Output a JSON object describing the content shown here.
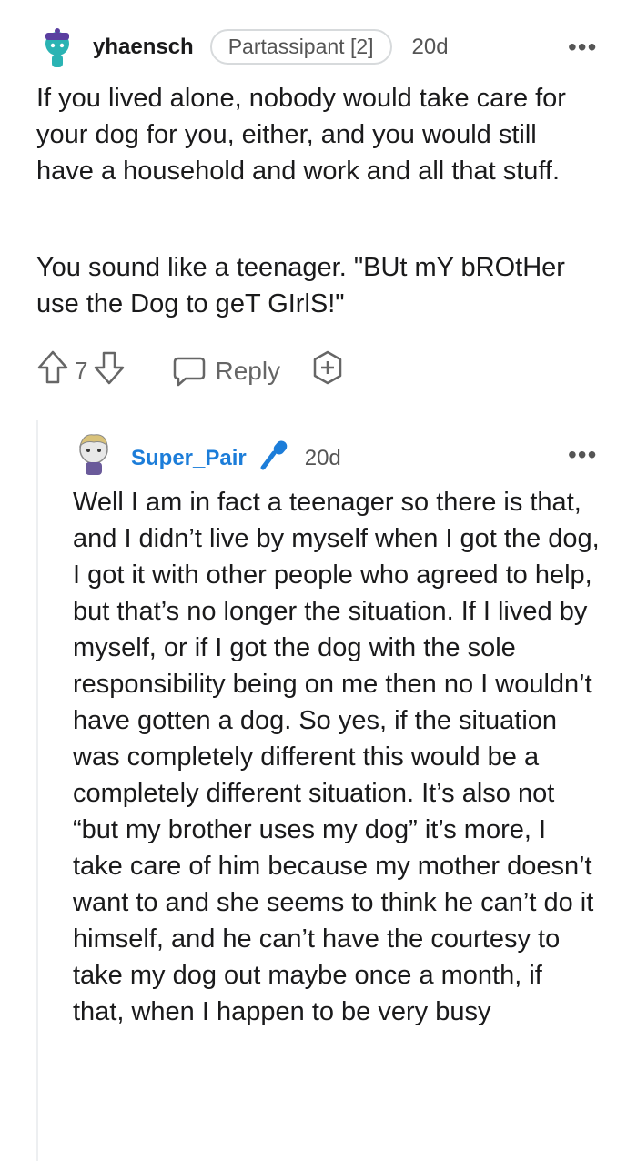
{
  "comment": {
    "username": "yhaensch",
    "flair": "Partassipant [2]",
    "time": "20d",
    "more_icon": "more-dots-icon",
    "paragraphs": [
      "If you lived alone, nobody would take care for your dog for you, either, and you would still have a household and work and all that stuff.",
      "You sound like a teenager. \"BUt mY bROtHer use the Dog to geT GIrlS!\""
    ],
    "vote_count": "7",
    "reply_label": "Reply"
  },
  "reply": {
    "username": "Super_Pair",
    "time": "20d",
    "body": "Well I am in fact a teenager so there is that, and I didn’t live by myself when I got the dog, I got it with other people who agreed to help, but that’s no longer the situation. If I lived by myself, or if I got the dog with the sole responsibility being on me then no I wouldn’t have gotten a dog. So yes, if the situation was completely different this would be a completely different situation. It’s also not “but my brother uses my dog” it’s more, I take care of him because my mother doesn’t want to and she seems to think he can’t do it himself, and he can’t have the courtesy to take my dog out maybe once a month, if that, when I happen to be very busy"
  },
  "colors": {
    "reply_username": "#1c7dd9",
    "text": "#1a1a1b",
    "muted": "#555555"
  }
}
